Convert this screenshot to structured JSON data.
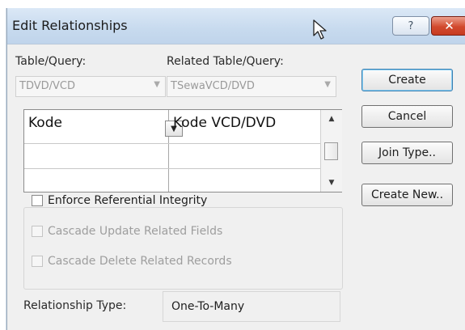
{
  "window": {
    "title": "Edit Relationships",
    "help_glyph": "?",
    "close_glyph": "✕"
  },
  "fields": {
    "table_label": "Table/Query:",
    "related_label": "Related Table/Query:",
    "table_value": "TDVD/VCD",
    "related_value": "TSewaVCD/DVD"
  },
  "grid": {
    "rows": [
      [
        "Kode",
        "Kode VCD/DVD"
      ],
      [
        "",
        ""
      ],
      [
        "",
        ""
      ]
    ]
  },
  "buttons": {
    "create": "Create",
    "cancel": "Cancel",
    "join_type": "Join Type..",
    "create_new": "Create New.."
  },
  "options": {
    "enforce": "Enforce Referential Integrity",
    "cascade_update": "Cascade Update Related Fields",
    "cascade_delete": "Cascade Delete Related Records"
  },
  "relationship": {
    "label": "Relationship Type:",
    "value": "One-To-Many"
  }
}
